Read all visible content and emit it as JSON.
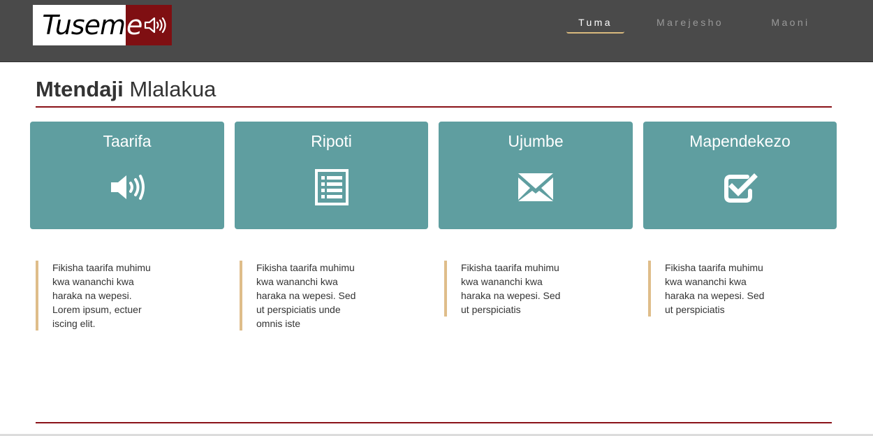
{
  "header": {
    "logo": {
      "text_left": "Tusem",
      "text_right": "e",
      "icon": "speaker-icon"
    },
    "nav": [
      {
        "label": "Tuma",
        "active": true
      },
      {
        "label": "Marejesho",
        "active": false
      },
      {
        "label": "Maoni",
        "active": false
      }
    ]
  },
  "page": {
    "title_bold": "Mtendaji",
    "title_normal": "Mlalakua"
  },
  "cards": [
    {
      "title": "Taarifa",
      "icon": "speaker-icon"
    },
    {
      "title": "Ripoti",
      "icon": "document-list-icon"
    },
    {
      "title": "Ujumbe",
      "icon": "envelope-icon"
    },
    {
      "title": "Mapendekezo",
      "icon": "check-square-icon"
    }
  ],
  "descriptions": [
    {
      "lines": [
        "Fikisha taarifa muhimu",
        "kwa wananchi kwa",
        "haraka na wepesi.",
        "Lorem ipsum, ectuer",
        "iscing elit."
      ]
    },
    {
      "lines": [
        "Fikisha taarifa muhimu",
        "kwa wananchi kwa",
        "haraka na wepesi. Sed",
        "ut perspiciatis unde",
        "omnis iste"
      ]
    },
    {
      "lines": [
        "Fikisha taarifa muhimu",
        "kwa wananchi kwa",
        "haraka na wepesi. Sed",
        "ut perspiciatis"
      ]
    },
    {
      "lines": [
        "Fikisha taarifa muhimu",
        "kwa wananchi kwa",
        "haraka na wepesi. Sed",
        "ut perspiciatis"
      ]
    }
  ],
  "colors": {
    "header_bg": "#4a4a4a",
    "card_bg": "#5f9ea0",
    "accent_red": "#8a1219",
    "accent_tan": "#dfbd8a"
  }
}
